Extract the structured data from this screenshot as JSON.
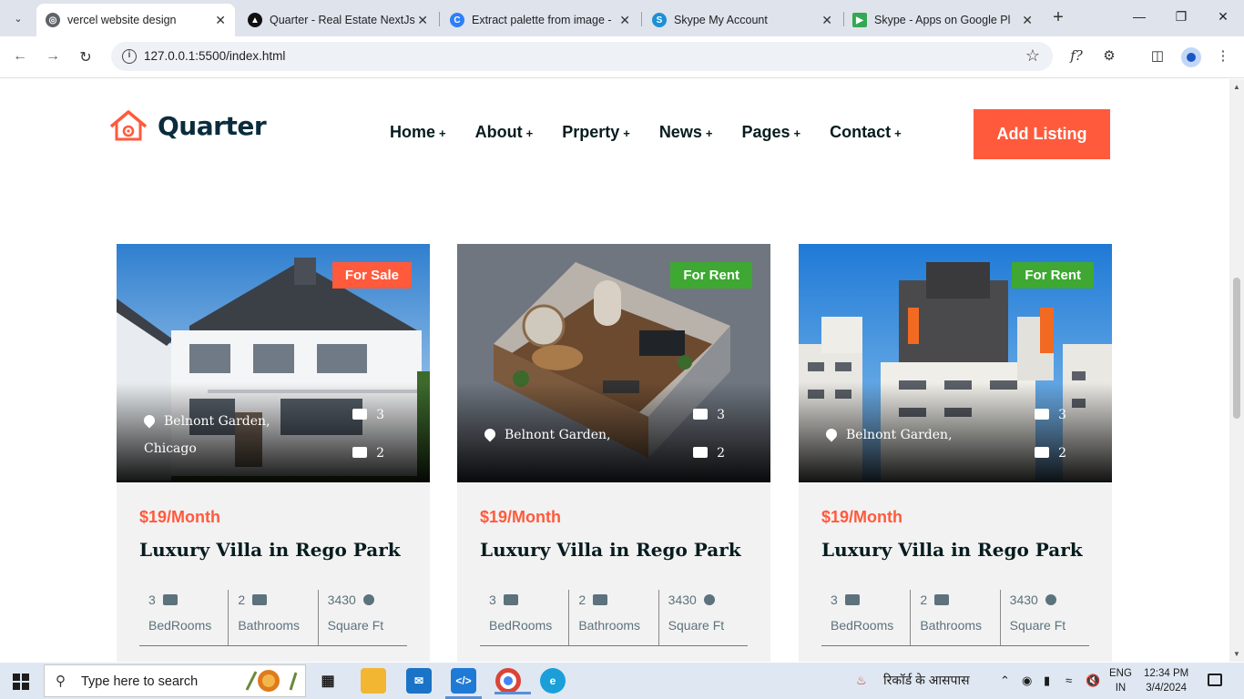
{
  "browser": {
    "tabs": [
      {
        "title": "vercel website design",
        "active": true,
        "favicon": "globe-icon",
        "color": "#5f6368"
      },
      {
        "title": "Quarter - Real Estate NextJs",
        "active": false,
        "favicon": "triangle-icon",
        "color": "#111111"
      },
      {
        "title": "Extract palette from image -",
        "active": false,
        "favicon": "c-logo-icon",
        "color": "#2d7ff9"
      },
      {
        "title": "Skype My Account",
        "active": false,
        "favicon": "skype-icon",
        "color": "#1e90d6"
      },
      {
        "title": "Skype - Apps on Google Play",
        "active": false,
        "favicon": "play-icon",
        "color": "#34a853"
      }
    ],
    "url": "127.0.0.1:5500/index.html"
  },
  "header": {
    "logo_text": "Quarter",
    "nav": [
      {
        "label": "Home",
        "plus": "+"
      },
      {
        "label": "About",
        "plus": "+"
      },
      {
        "label": "Prperty",
        "plus": "+"
      },
      {
        "label": "News",
        "plus": "+"
      },
      {
        "label": "Pages",
        "plus": "+"
      },
      {
        "label": "Contact",
        "plus": "+"
      }
    ],
    "cta_label": "Add Listing"
  },
  "colors": {
    "accent": "#ff5a3c",
    "sale": "#ff5a3c",
    "rent": "#3ea832",
    "heading": "#071c1f",
    "muted": "#5c727d"
  },
  "cards": [
    {
      "badge": "For Sale",
      "badge_type": "sale",
      "location_line1": "Belnont Garden,",
      "location_line2": "Chicago",
      "photos": "3",
      "videos": "2",
      "price": "$19/Month",
      "title": "Luxury Villa in Rego Park",
      "bedrooms": "3",
      "bedrooms_label": "BedRooms",
      "bathrooms": "2",
      "bathrooms_label": "Bathrooms",
      "area": "3430",
      "area_label": "Square Ft"
    },
    {
      "badge": "For Rent",
      "badge_type": "rent",
      "location_line1": "Belnont Garden,",
      "location_line2": "",
      "photos": "3",
      "videos": "2",
      "price": "$19/Month",
      "title": "Luxury Villa in Rego Park",
      "bedrooms": "3",
      "bedrooms_label": "BedRooms",
      "bathrooms": "2",
      "bathrooms_label": "Bathrooms",
      "area": "3430",
      "area_label": "Square Ft"
    },
    {
      "badge": "For Rent",
      "badge_type": "rent",
      "location_line1": "Belnont Garden,",
      "location_line2": "",
      "photos": "3",
      "videos": "2",
      "price": "$19/Month",
      "title": "Luxury Villa in Rego Park",
      "bedrooms": "3",
      "bedrooms_label": "BedRooms",
      "bathrooms": "2",
      "bathrooms_label": "Bathrooms",
      "area": "3430",
      "area_label": "Square Ft"
    }
  ],
  "taskbar": {
    "search_placeholder": "Type here to search",
    "tray_text": "रिकॉर्ड के आसपास",
    "lang_line1": "ENG",
    "lang_line2": "IN",
    "time": "12:34 PM",
    "date": "3/4/2024"
  }
}
